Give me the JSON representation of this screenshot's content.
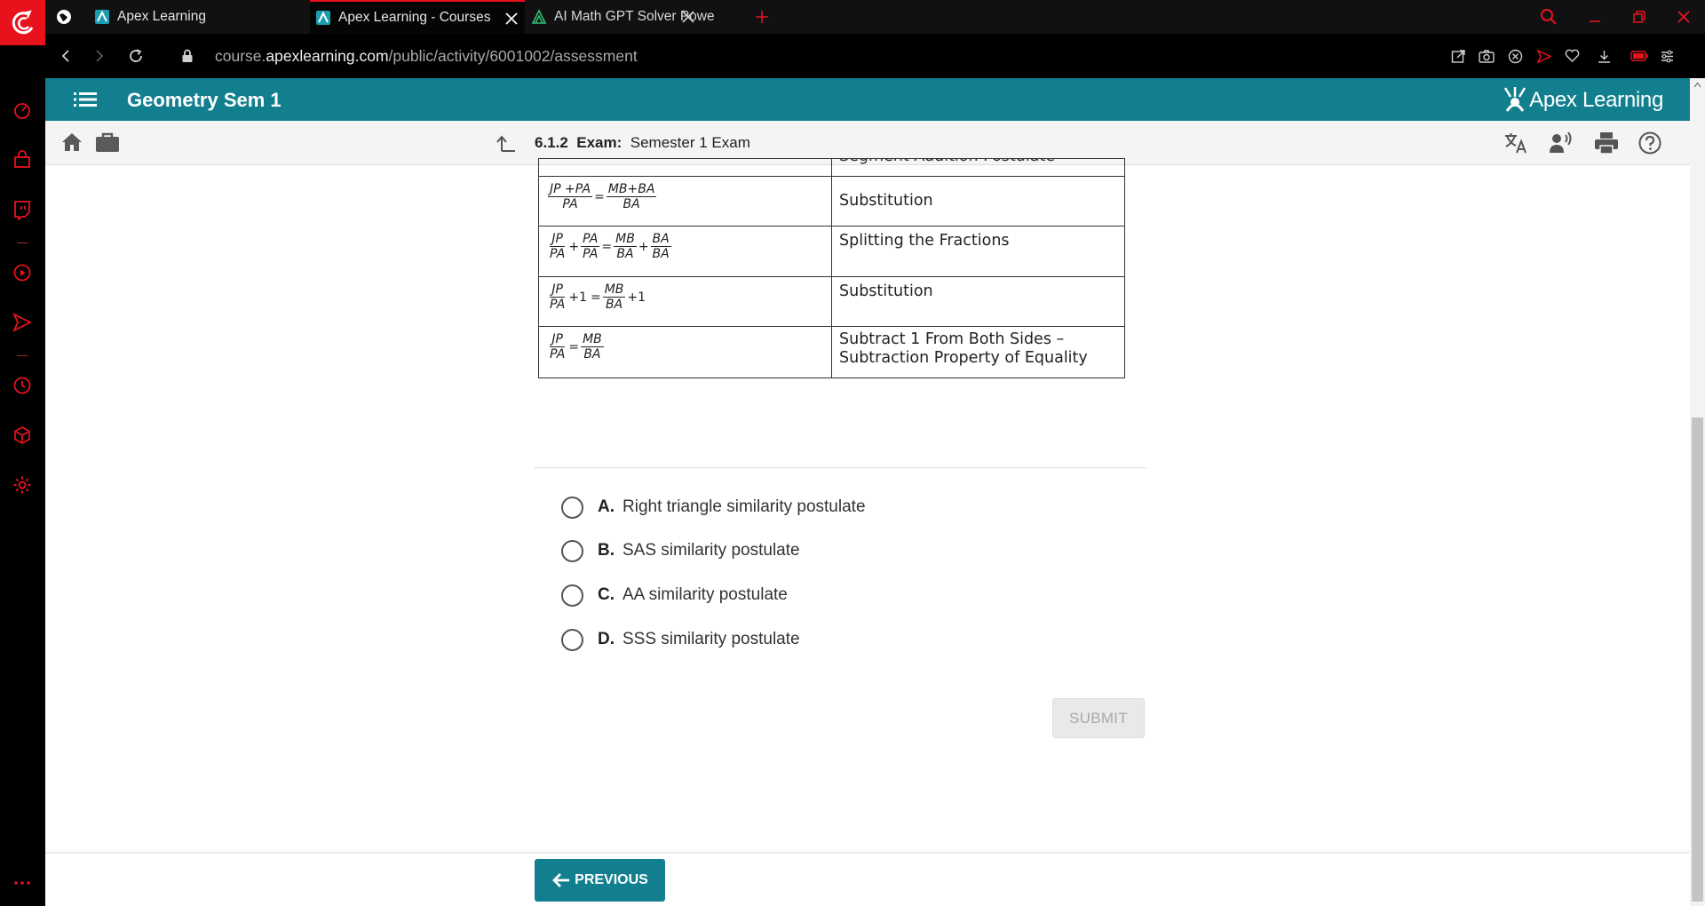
{
  "browser": {
    "tabs": [
      {
        "label": "Apex Learning",
        "active": false
      },
      {
        "label": "Apex Learning - Courses",
        "active": true
      },
      {
        "label": "AI Math GPT Solver Powere",
        "active": false
      }
    ],
    "url": {
      "prefix": "course.",
      "host": "apexlearning.com",
      "path": "/public/activity/6001002/assessment"
    },
    "accent_color": "#e8121d"
  },
  "header": {
    "course_title": "Geometry Sem 1",
    "logo_text": "Apex Learning"
  },
  "toolbar": {
    "activity_number": "6.1.2",
    "activity_type": "Exam:",
    "activity_title": "Semester 1 Exam"
  },
  "proof": {
    "partial_top_reason": "Segment Addition Postulate",
    "rows": [
      {
        "reason": "Substitution"
      },
      {
        "reason": "Splitting the Fractions"
      },
      {
        "reason": "Substitution"
      },
      {
        "reason": "Subtract 1 From Both Sides –",
        "reason_line2": "Subtraction Property of Equality"
      }
    ],
    "math": {
      "r1_left_num": "JP +PA",
      "r1_left_den": "PA",
      "r1_right_num": "MB+BA",
      "r1_right_den": "BA",
      "r2_a_num": "JP",
      "r2_a_den": "PA",
      "r2_b_num": "PA",
      "r2_b_den": "PA",
      "r2_c_num": "MB",
      "r2_c_den": "BA",
      "r2_d_num": "BA",
      "r2_d_den": "BA",
      "r3_left_num": "JP",
      "r3_left_den": "PA",
      "r3_right_num": "MB",
      "r3_right_den": "BA",
      "r4_left_num": "JP",
      "r4_left_den": "PA",
      "r4_right_num": "MB",
      "r4_right_den": "BA",
      "plus": "+",
      "equals": "=",
      "plus_one": "+1"
    }
  },
  "choices": [
    {
      "letter": "A.",
      "text": "Right triangle similarity postulate"
    },
    {
      "letter": "B.",
      "text": "SAS similarity postulate"
    },
    {
      "letter": "C.",
      "text": "AA similarity postulate"
    },
    {
      "letter": "D.",
      "text": "SSS similarity postulate"
    }
  ],
  "buttons": {
    "submit": "SUBMIT",
    "previous": "PREVIOUS"
  },
  "colors": {
    "teal": "#127f8f"
  }
}
